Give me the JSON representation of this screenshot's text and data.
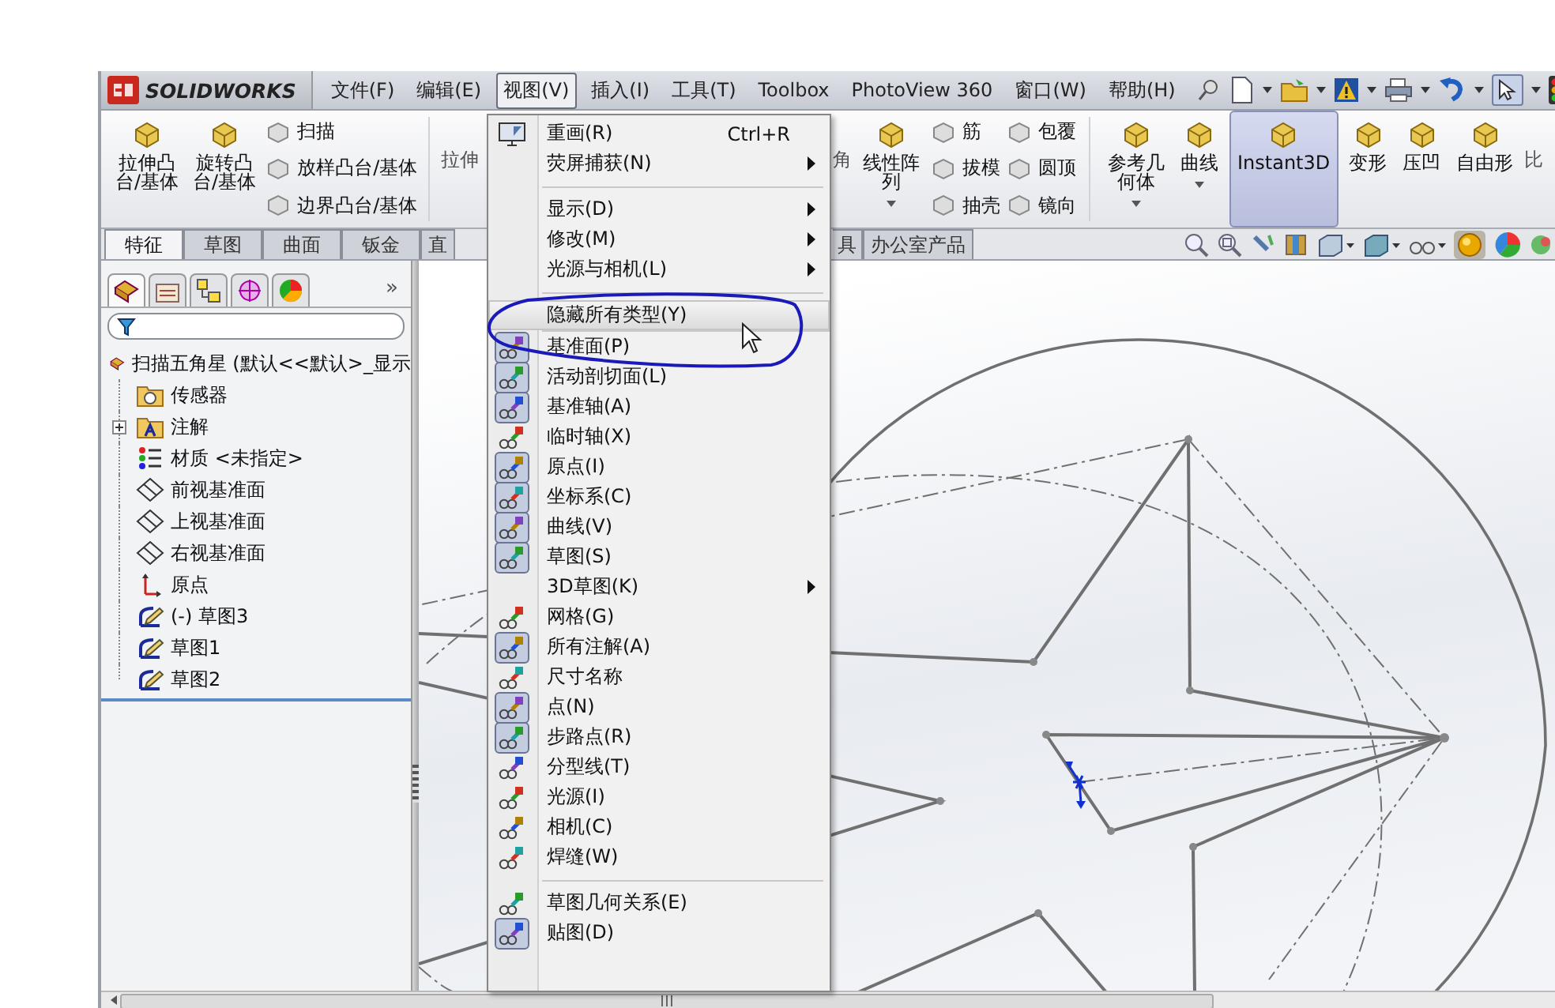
{
  "app": {
    "logo": "SOLIDWORKS"
  },
  "menubar": [
    {
      "label": "文件(F)",
      "selected": false
    },
    {
      "label": "编辑(E)",
      "selected": false
    },
    {
      "label": "视图(V)",
      "selected": true
    },
    {
      "label": "插入(I)",
      "selected": false
    },
    {
      "label": "工具(T)",
      "selected": false
    },
    {
      "label": "Toolbox",
      "selected": false
    },
    {
      "label": "PhotoView 360",
      "selected": false
    },
    {
      "label": "窗口(W)",
      "selected": false
    },
    {
      "label": "帮助(H)",
      "selected": false
    }
  ],
  "ribbon": {
    "left": [
      {
        "kind": "large",
        "lines": [
          "拉伸凸",
          "台/基体"
        ]
      },
      {
        "kind": "large",
        "lines": [
          "旋转凸",
          "台/基体"
        ]
      },
      {
        "kind": "stack",
        "items": [
          "扫描",
          "放样凸台/基体",
          "边界凸台/基体"
        ]
      },
      {
        "kind": "cut",
        "lines": [
          "拉伸"
        ]
      }
    ],
    "right": [
      {
        "kind": "cut",
        "lines": [
          "角"
        ]
      },
      {
        "kind": "dropdown",
        "lines": [
          "线性阵",
          "列"
        ]
      },
      {
        "kind": "stack",
        "items": [
          "筋",
          "拔模",
          "抽壳"
        ]
      },
      {
        "kind": "stack",
        "items": [
          "包覆",
          "圆顶",
          "镜向"
        ]
      },
      {
        "kind": "dropdown",
        "lines": [
          "参考几",
          "何体"
        ]
      },
      {
        "kind": "dropdown",
        "lines": [
          "曲线"
        ]
      },
      {
        "kind": "toggle",
        "on": true,
        "lines": [
          "Instant3D"
        ]
      },
      {
        "kind": "large",
        "lines": [
          "变形"
        ]
      },
      {
        "kind": "large",
        "lines": [
          "压凹"
        ]
      },
      {
        "kind": "large",
        "lines": [
          "自由形"
        ]
      },
      {
        "kind": "cut",
        "lines": [
          "比"
        ]
      }
    ]
  },
  "tabs_left": [
    {
      "label": "特征",
      "selected": true
    },
    {
      "label": "草图",
      "selected": false
    },
    {
      "label": "曲面",
      "selected": false
    },
    {
      "label": "钣金",
      "selected": false
    },
    {
      "label": "直",
      "selected": false
    }
  ],
  "tabs_right": [
    {
      "label": "具",
      "selected": false
    },
    {
      "label": "办公室产品",
      "selected": false
    }
  ],
  "panel": {
    "tabs": [
      {
        "selected": true
      },
      {
        "selected": false
      },
      {
        "selected": false
      },
      {
        "selected": false
      },
      {
        "selected": false
      }
    ],
    "more": "»",
    "tree": {
      "label": "扫描五角星 (默认<<默认>_显示",
      "kind": "part",
      "children": [
        {
          "label": "传感器",
          "kind": "sensor"
        },
        {
          "label": "注解",
          "kind": "annotation",
          "expanded": false
        },
        {
          "label": "材质 <未指定>",
          "kind": "material"
        },
        {
          "label": "前视基准面",
          "kind": "plane"
        },
        {
          "label": "上视基准面",
          "kind": "plane"
        },
        {
          "label": "右视基准面",
          "kind": "plane"
        },
        {
          "label": "原点",
          "kind": "origin"
        },
        {
          "label": "(-) 草图3",
          "kind": "sketch"
        },
        {
          "label": "草图1",
          "kind": "sketch"
        },
        {
          "label": "草图2",
          "kind": "sketch"
        }
      ]
    }
  },
  "view_menu": [
    {
      "kind": "command",
      "label": "重画(R)",
      "shortcut": "Ctrl+R",
      "selected": false
    },
    {
      "kind": "submenu",
      "label": "荧屏捕获(N)",
      "selected": false
    },
    {
      "kind": "separator"
    },
    {
      "kind": "submenu",
      "label": "显示(D)",
      "selected": false
    },
    {
      "kind": "submenu",
      "label": "修改(M)",
      "selected": false
    },
    {
      "kind": "submenu",
      "label": "光源与相机(L)",
      "selected": false
    },
    {
      "kind": "separator"
    },
    {
      "kind": "command",
      "label": "隐藏所有类型(Y)",
      "selected": true
    },
    {
      "kind": "line"
    },
    {
      "kind": "toggle",
      "label": "基准面(P)",
      "on": true,
      "selected": false
    },
    {
      "kind": "toggle",
      "label": "活动剖切面(L)",
      "on": true,
      "selected": false
    },
    {
      "kind": "toggle",
      "label": "基准轴(A)",
      "on": true,
      "selected": false
    },
    {
      "kind": "toggle",
      "label": "临时轴(X)",
      "on": false,
      "selected": false
    },
    {
      "kind": "toggle",
      "label": "原点(I)",
      "on": true,
      "selected": false
    },
    {
      "kind": "toggle",
      "label": "坐标系(C)",
      "on": true,
      "selected": false
    },
    {
      "kind": "toggle",
      "label": "曲线(V)",
      "on": true,
      "selected": false
    },
    {
      "kind": "toggle",
      "label": "草图(S)",
      "on": true,
      "selected": false
    },
    {
      "kind": "submenu",
      "label": "3D草图(K)",
      "selected": false
    },
    {
      "kind": "toggle",
      "label": "网格(G)",
      "on": false,
      "selected": false
    },
    {
      "kind": "toggle",
      "label": "所有注解(A)",
      "on": true,
      "selected": false
    },
    {
      "kind": "toggle",
      "label": "尺寸名称",
      "on": false,
      "selected": false
    },
    {
      "kind": "toggle",
      "label": "点(N)",
      "on": true,
      "selected": false
    },
    {
      "kind": "toggle",
      "label": "步路点(R)",
      "on": true,
      "selected": false
    },
    {
      "kind": "toggle",
      "label": "分型线(T)",
      "on": false,
      "selected": false
    },
    {
      "kind": "toggle",
      "label": "光源(I)",
      "on": false,
      "selected": false
    },
    {
      "kind": "toggle",
      "label": "相机(C)",
      "on": false,
      "selected": false
    },
    {
      "kind": "toggle",
      "label": "焊缝(W)",
      "on": false,
      "selected": false
    },
    {
      "kind": "separator"
    },
    {
      "kind": "toggle",
      "label": "草图几何关系(E)",
      "on": false,
      "selected": false
    },
    {
      "kind": "toggle",
      "label": "贴图(D)",
      "on": true,
      "selected": false
    }
  ]
}
